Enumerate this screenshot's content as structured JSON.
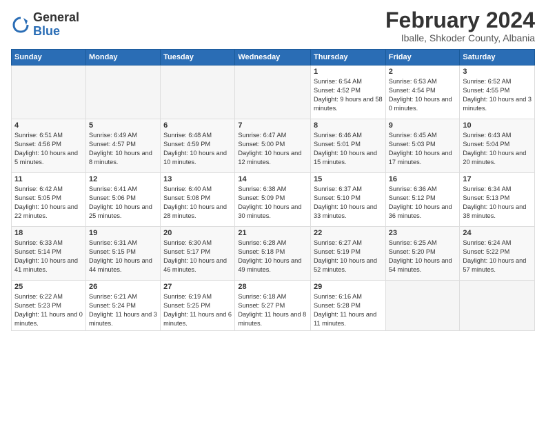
{
  "logo": {
    "general": "General",
    "blue": "Blue"
  },
  "title": {
    "month": "February 2024",
    "location": "Iballe, Shkoder County, Albania"
  },
  "headers": [
    "Sunday",
    "Monday",
    "Tuesday",
    "Wednesday",
    "Thursday",
    "Friday",
    "Saturday"
  ],
  "weeks": [
    [
      {
        "day": "",
        "info": ""
      },
      {
        "day": "",
        "info": ""
      },
      {
        "day": "",
        "info": ""
      },
      {
        "day": "",
        "info": ""
      },
      {
        "day": "1",
        "info": "Sunrise: 6:54 AM\nSunset: 4:52 PM\nDaylight: 9 hours and 58 minutes."
      },
      {
        "day": "2",
        "info": "Sunrise: 6:53 AM\nSunset: 4:54 PM\nDaylight: 10 hours and 0 minutes."
      },
      {
        "day": "3",
        "info": "Sunrise: 6:52 AM\nSunset: 4:55 PM\nDaylight: 10 hours and 3 minutes."
      }
    ],
    [
      {
        "day": "4",
        "info": "Sunrise: 6:51 AM\nSunset: 4:56 PM\nDaylight: 10 hours and 5 minutes."
      },
      {
        "day": "5",
        "info": "Sunrise: 6:49 AM\nSunset: 4:57 PM\nDaylight: 10 hours and 8 minutes."
      },
      {
        "day": "6",
        "info": "Sunrise: 6:48 AM\nSunset: 4:59 PM\nDaylight: 10 hours and 10 minutes."
      },
      {
        "day": "7",
        "info": "Sunrise: 6:47 AM\nSunset: 5:00 PM\nDaylight: 10 hours and 12 minutes."
      },
      {
        "day": "8",
        "info": "Sunrise: 6:46 AM\nSunset: 5:01 PM\nDaylight: 10 hours and 15 minutes."
      },
      {
        "day": "9",
        "info": "Sunrise: 6:45 AM\nSunset: 5:03 PM\nDaylight: 10 hours and 17 minutes."
      },
      {
        "day": "10",
        "info": "Sunrise: 6:43 AM\nSunset: 5:04 PM\nDaylight: 10 hours and 20 minutes."
      }
    ],
    [
      {
        "day": "11",
        "info": "Sunrise: 6:42 AM\nSunset: 5:05 PM\nDaylight: 10 hours and 22 minutes."
      },
      {
        "day": "12",
        "info": "Sunrise: 6:41 AM\nSunset: 5:06 PM\nDaylight: 10 hours and 25 minutes."
      },
      {
        "day": "13",
        "info": "Sunrise: 6:40 AM\nSunset: 5:08 PM\nDaylight: 10 hours and 28 minutes."
      },
      {
        "day": "14",
        "info": "Sunrise: 6:38 AM\nSunset: 5:09 PM\nDaylight: 10 hours and 30 minutes."
      },
      {
        "day": "15",
        "info": "Sunrise: 6:37 AM\nSunset: 5:10 PM\nDaylight: 10 hours and 33 minutes."
      },
      {
        "day": "16",
        "info": "Sunrise: 6:36 AM\nSunset: 5:12 PM\nDaylight: 10 hours and 36 minutes."
      },
      {
        "day": "17",
        "info": "Sunrise: 6:34 AM\nSunset: 5:13 PM\nDaylight: 10 hours and 38 minutes."
      }
    ],
    [
      {
        "day": "18",
        "info": "Sunrise: 6:33 AM\nSunset: 5:14 PM\nDaylight: 10 hours and 41 minutes."
      },
      {
        "day": "19",
        "info": "Sunrise: 6:31 AM\nSunset: 5:15 PM\nDaylight: 10 hours and 44 minutes."
      },
      {
        "day": "20",
        "info": "Sunrise: 6:30 AM\nSunset: 5:17 PM\nDaylight: 10 hours and 46 minutes."
      },
      {
        "day": "21",
        "info": "Sunrise: 6:28 AM\nSunset: 5:18 PM\nDaylight: 10 hours and 49 minutes."
      },
      {
        "day": "22",
        "info": "Sunrise: 6:27 AM\nSunset: 5:19 PM\nDaylight: 10 hours and 52 minutes."
      },
      {
        "day": "23",
        "info": "Sunrise: 6:25 AM\nSunset: 5:20 PM\nDaylight: 10 hours and 54 minutes."
      },
      {
        "day": "24",
        "info": "Sunrise: 6:24 AM\nSunset: 5:22 PM\nDaylight: 10 hours and 57 minutes."
      }
    ],
    [
      {
        "day": "25",
        "info": "Sunrise: 6:22 AM\nSunset: 5:23 PM\nDaylight: 11 hours and 0 minutes."
      },
      {
        "day": "26",
        "info": "Sunrise: 6:21 AM\nSunset: 5:24 PM\nDaylight: 11 hours and 3 minutes."
      },
      {
        "day": "27",
        "info": "Sunrise: 6:19 AM\nSunset: 5:25 PM\nDaylight: 11 hours and 6 minutes."
      },
      {
        "day": "28",
        "info": "Sunrise: 6:18 AM\nSunset: 5:27 PM\nDaylight: 11 hours and 8 minutes."
      },
      {
        "day": "29",
        "info": "Sunrise: 6:16 AM\nSunset: 5:28 PM\nDaylight: 11 hours and 11 minutes."
      },
      {
        "day": "",
        "info": ""
      },
      {
        "day": "",
        "info": ""
      }
    ]
  ]
}
